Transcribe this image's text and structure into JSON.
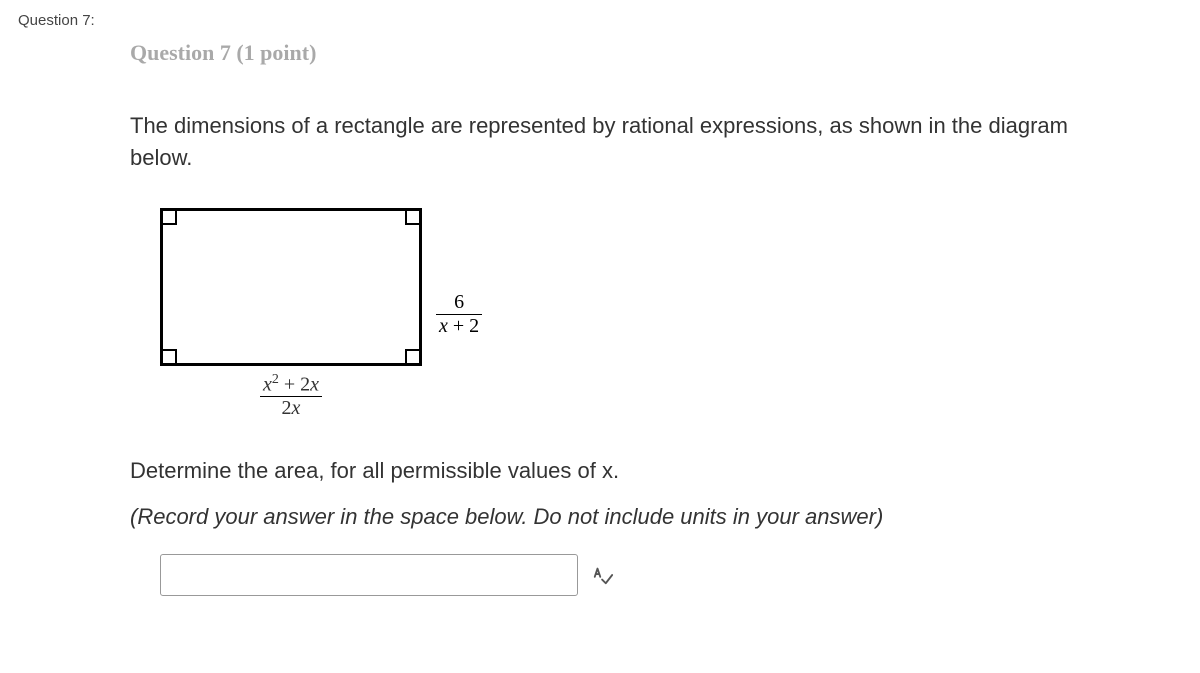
{
  "question_label": "Question 7:",
  "cutoff": "Question 7 (1 point)",
  "prompt": "The dimensions of a rectangle are represented by rational expressions, as shown in the diagram below.",
  "diagram": {
    "right_label_num": "6",
    "right_label_den_pre": "x",
    "right_label_den_post": " + 2",
    "bottom_label_num_pre": "x",
    "bottom_label_num_sup": "2",
    "bottom_label_num_post": " + 2",
    "bottom_label_num_end": "x",
    "bottom_label_den_pre": "2",
    "bottom_label_den_post": "x"
  },
  "instruction": "Determine the area, for all permissible values of x.",
  "note": "(Record your answer in the space below.  Do not include units in your answer)",
  "answer_value": "",
  "icon_label": "A✓"
}
